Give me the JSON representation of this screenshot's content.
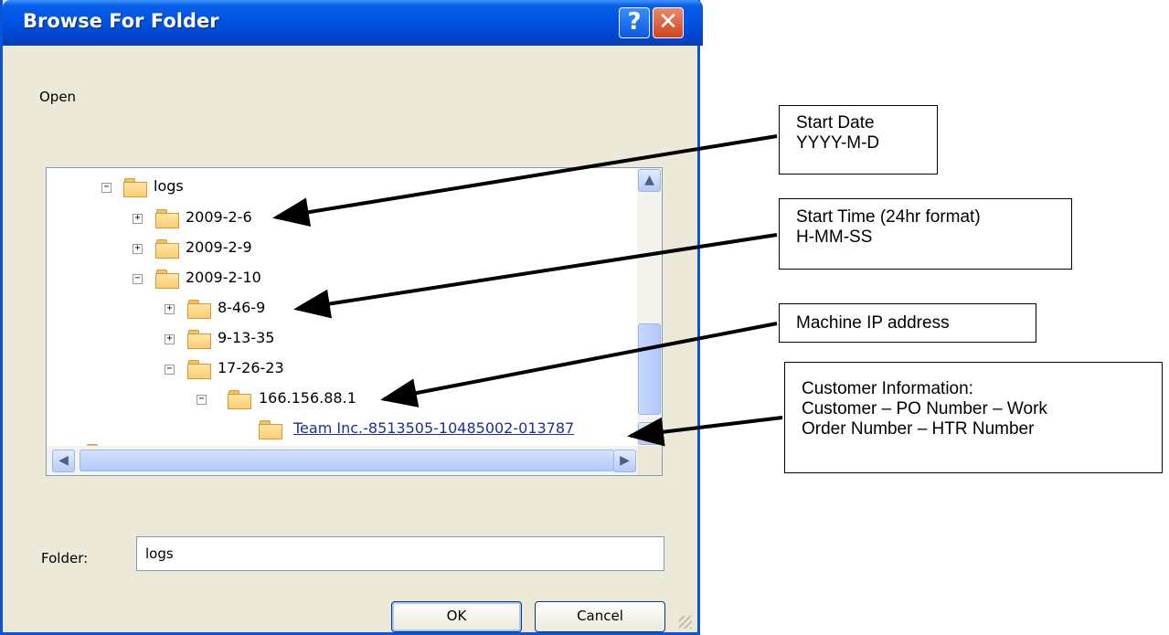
{
  "dialog": {
    "title": "Browse For Folder",
    "help_icon": "?",
    "close_icon": "✕",
    "prompt": "Open",
    "folder_label": "Folder:",
    "folder_value": "logs",
    "ok_label": "OK",
    "cancel_label": "Cancel"
  },
  "tree": {
    "items": [
      {
        "label": "logs",
        "toggle": "−"
      },
      {
        "label": "2009-2-6",
        "toggle": "+"
      },
      {
        "label": "2009-2-9",
        "toggle": "+"
      },
      {
        "label": "2009-2-10",
        "toggle": "−"
      },
      {
        "label": "8-46-9",
        "toggle": "+"
      },
      {
        "label": "9-13-35",
        "toggle": "+"
      },
      {
        "label": "17-26-23",
        "toggle": "−"
      },
      {
        "label": "166.156.88.1",
        "toggle": "−"
      },
      {
        "label": "Team Inc.-8513505-10485002-013787",
        "toggle": ""
      }
    ],
    "scroll_up_icon": "▲",
    "scroll_down_icon": "▼",
    "scroll_left_icon": "◀",
    "scroll_right_icon": "▶"
  },
  "notes": {
    "start_date_1": "Start Date",
    "start_date_2": "YYYY-M-D",
    "start_time_1": "Start Time (24hr format)",
    "start_time_2": "H-MM-SS",
    "machine_ip": "Machine IP address",
    "customer_1": "Customer Information:",
    "customer_2": "Customer – PO Number – Work",
    "customer_3": "Order Number – HTR Number"
  },
  "colors": {
    "titlebar": "#0054e3",
    "close_button": "#d1431c",
    "dialog_bg": "#ece9d8",
    "selected_text": "#1b2f9c",
    "folder_fill": "#fbcc74"
  }
}
